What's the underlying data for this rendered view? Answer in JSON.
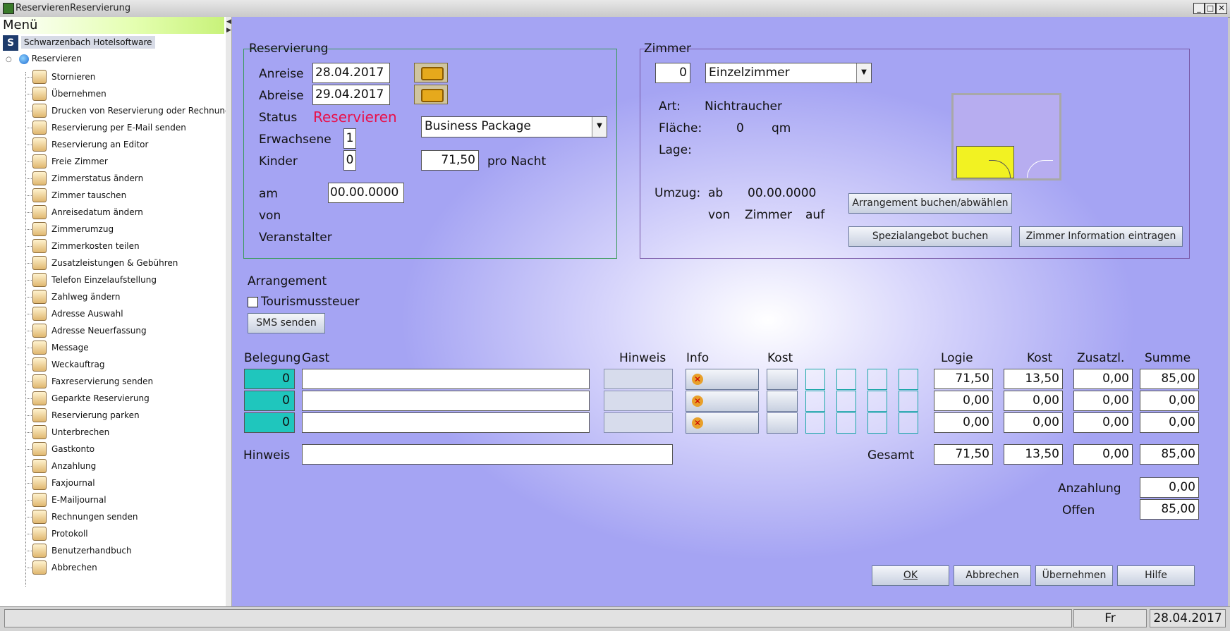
{
  "window": {
    "title": "ReservierenReservierung"
  },
  "sidebar": {
    "menu_title": "Menü",
    "brand": "Schwarzenbach Hotelsoftware",
    "root": "Reservieren",
    "items": [
      {
        "label": "Stornieren",
        "icon": "cancel-icon"
      },
      {
        "label": "Übernehmen",
        "icon": "save-icon"
      },
      {
        "label": "Drucken von Reservierung oder Rechnung",
        "icon": "print-icon"
      },
      {
        "label": "Reservierung per E-Mail senden",
        "icon": "email-icon"
      },
      {
        "label": "Reservierung an Editor",
        "icon": "document-icon"
      },
      {
        "label": "Freie Zimmer",
        "icon": "bed-icon"
      },
      {
        "label": "Zimmerstatus ändern",
        "icon": "room-status-icon"
      },
      {
        "label": "Zimmer tauschen",
        "icon": "swap-icon"
      },
      {
        "label": "Anreisedatum ändern",
        "icon": "calendar-icon"
      },
      {
        "label": "Zimmerumzug",
        "icon": "move-icon"
      },
      {
        "label": "Zimmerkosten teilen",
        "icon": "split-icon"
      },
      {
        "label": "Zusatzleistungen & Gebühren",
        "icon": "extras-icon"
      },
      {
        "label": "Telefon Einzelaufstellung",
        "icon": "phone-icon"
      },
      {
        "label": "Zahlweg ändern",
        "icon": "payment-icon"
      },
      {
        "label": "Adresse Auswahl",
        "icon": "address-select-icon"
      },
      {
        "label": "Adresse Neuerfassung",
        "icon": "address-new-icon"
      },
      {
        "label": "Message",
        "icon": "message-icon"
      },
      {
        "label": "Weckauftrag",
        "icon": "alarm-icon"
      },
      {
        "label": "Faxreservierung senden",
        "icon": "fax-icon"
      },
      {
        "label": "Geparkte Reservierung",
        "icon": "parked-icon"
      },
      {
        "label": "Reservierung parken",
        "icon": "park-icon"
      },
      {
        "label": "Unterbrechen",
        "icon": "pause-icon"
      },
      {
        "label": "Gastkonto",
        "icon": "info-icon"
      },
      {
        "label": "Anzahlung",
        "icon": "deposit-icon"
      },
      {
        "label": "Faxjournal",
        "icon": "fax-journal-icon"
      },
      {
        "label": "E-Mailjournal",
        "icon": "email-journal-icon"
      },
      {
        "label": "Rechnungen senden",
        "icon": "invoice-icon"
      },
      {
        "label": "Protokoll",
        "icon": "log-icon"
      },
      {
        "label": "Benutzerhandbuch",
        "icon": "help-icon"
      },
      {
        "label": "Abbrechen",
        "icon": "exit-icon"
      }
    ]
  },
  "reservierung": {
    "legend": "Reservierung",
    "anreise_label": "Anreise",
    "anreise": "28.04.2017",
    "abreise_label": "Abreise",
    "abreise": "29.04.2017",
    "status_label": "Status",
    "status": "Reservieren",
    "erwachsene_label": "Erwachsene",
    "erwachsene": "1",
    "kinder_label": "Kinder",
    "kinder": "0",
    "package": "Business Package",
    "price": "71,50",
    "price_unit": "pro Nacht",
    "am_label": "am",
    "am": "00.00.0000",
    "von_label": "von",
    "veranstalter_label": "Veranstalter"
  },
  "zimmer": {
    "legend": "Zimmer",
    "number": "0",
    "type": "Einzelzimmer",
    "art_label": "Art:",
    "art": "Nichtraucher",
    "flaeche_label": "Fläche:",
    "flaeche": "0",
    "flaeche_unit": "qm",
    "lage_label": "Lage:",
    "umzug_label": "Umzug:",
    "ab_label": "ab",
    "umzug_date": "00.00.0000",
    "von_label": "von",
    "zimmer_label": "Zimmer",
    "auf_label": "auf",
    "btn_arrangement": "Arrangement buchen/abwählen",
    "btn_spezial": "Spezialangebot buchen",
    "btn_info": "Zimmer Information eintragen"
  },
  "arrangement": {
    "label": "Arrangement",
    "tourismus": "Tourismussteuer",
    "sms": "SMS senden"
  },
  "table": {
    "headers": {
      "belegung": "Belegung",
      "gast": "Gast",
      "hinweis": "Hinweis",
      "info": "Info",
      "kost": "Kost",
      "logie": "Logie",
      "kost2": "Kost",
      "zusatzl": "Zusatzl.",
      "summe": "Summe"
    },
    "rows": [
      {
        "belegung": "0",
        "logie": "71,50",
        "kost": "13,50",
        "zusatzl": "0,00",
        "summe": "85,00"
      },
      {
        "belegung": "0",
        "logie": "0,00",
        "kost": "0,00",
        "zusatzl": "0,00",
        "summe": "0,00"
      },
      {
        "belegung": "0",
        "logie": "0,00",
        "kost": "0,00",
        "zusatzl": "0,00",
        "summe": "0,00"
      }
    ],
    "hinweis_label": "Hinweis",
    "gesamt_label": "Gesamt",
    "gesamt": {
      "logie": "71,50",
      "kost": "13,50",
      "zusatzl": "0,00",
      "summe": "85,00"
    },
    "anzahlung_label": "Anzahlung",
    "anzahlung": "0,00",
    "offen_label": "Offen",
    "offen": "85,00"
  },
  "buttons": {
    "ok": "OK",
    "abbrechen": "Abbrechen",
    "uebernehmen": "Übernehmen",
    "hilfe": "Hilfe"
  },
  "statusbar": {
    "day": "Fr",
    "date": "28.04.2017"
  }
}
